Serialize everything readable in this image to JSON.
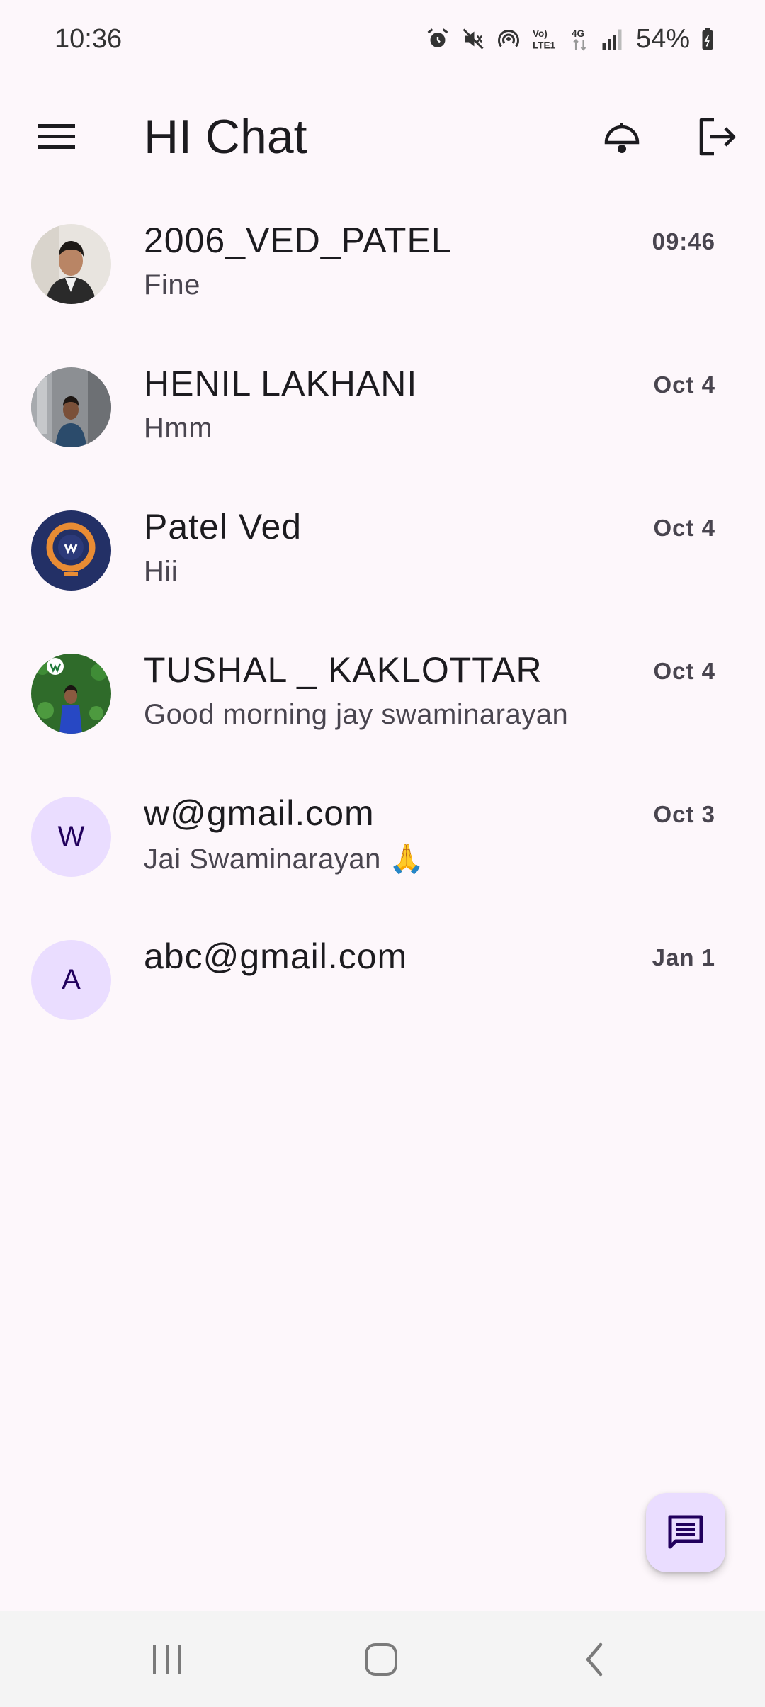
{
  "status_bar": {
    "time": "10:36",
    "battery": "54%",
    "icons": [
      "alarm-icon",
      "mute-icon",
      "hotspot-icon",
      "volte-icon",
      "4g-icon",
      "signal-icon",
      "battery-icon"
    ]
  },
  "app_bar": {
    "title": "HI Chat",
    "menu_icon": "menu-icon",
    "notification_icon": "bell-icon",
    "logout_icon": "logout-icon"
  },
  "chats": [
    {
      "name": "2006_VED_PATEL",
      "message": "Fine",
      "time": "09:46",
      "avatar_type": "photo"
    },
    {
      "name": "HENIL LAKHANI",
      "message": "Hmm",
      "time": "Oct 4",
      "avatar_type": "photo"
    },
    {
      "name": "Patel Ved",
      "message": "Hii",
      "time": "Oct 4",
      "avatar_type": "photo"
    },
    {
      "name": "TUSHAL _ KAKLOTTAR",
      "message": "Good morning jay swaminarayan",
      "time": "Oct 4",
      "avatar_type": "photo"
    },
    {
      "name": "w@gmail.com",
      "message": "Jai Swaminarayan 🙏",
      "time": "Oct 3",
      "avatar_type": "initial",
      "initial": "W"
    },
    {
      "name": "abc@gmail.com",
      "message": "",
      "time": "Jan 1",
      "avatar_type": "initial",
      "initial": "A"
    }
  ],
  "fab": {
    "icon": "new-chat-icon"
  },
  "nav_bar": {
    "icons": [
      "recents-icon",
      "home-icon",
      "back-icon"
    ]
  },
  "colors": {
    "background": "#fdf7fb",
    "avatar_initial_bg": "#eaddff",
    "avatar_initial_text": "#21005d",
    "fab_bg": "#eaddff"
  }
}
